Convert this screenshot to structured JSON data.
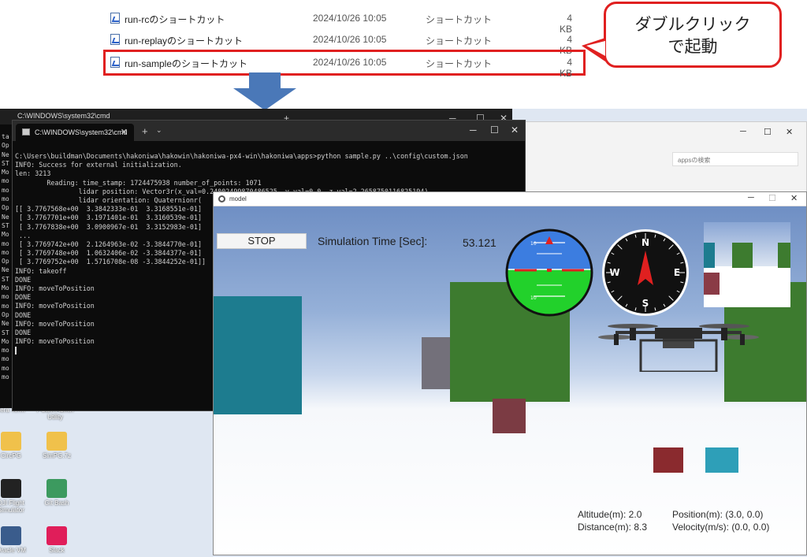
{
  "files": [
    {
      "name": "run-rcのショートカット",
      "date": "2024/10/26 10:05",
      "type": "ショートカット",
      "size": "4 KB"
    },
    {
      "name": "run-replayのショートカット",
      "date": "2024/10/26 10:05",
      "type": "ショートカット",
      "size": "4 KB"
    },
    {
      "name": "run-sampleのショートカット",
      "date": "2024/10/26 10:05",
      "type": "ショートカット",
      "size": "4 KB"
    }
  ],
  "callout": {
    "line1": "ダブルクリック",
    "line2": "で起動"
  },
  "terminal": {
    "tab_title": "C:\\WINDOWS\\system32\\cmd",
    "back_tab_title": "C:\\WINDOWS\\system32\\cmd",
    "lines": [
      "C:\\Users\\buildman\\Documents\\hakoniwa\\hakowin\\hakoniwa-px4-win\\hakoniwa\\apps>python sample.py ..\\config\\custom.json",
      "INFO: Success for external initialization.",
      "len: 3213",
      "        Reading: time_stamp: 1724475938 number_of_points: 1071",
      "                lidar position: Vector3r(x_val=0.24002499870486525, y_val=0.0, z_val=2.2658750116825194)",
      "                lidar orientation: Quaternionr(",
      "[[ 3.7767568e+00  3.3842333e-01  3.3168551e-01]",
      " [ 3.7767701e+00  3.1971401e-01  3.3160539e-01]",
      " [ 3.7767838e+00  3.0900967e-01  3.3152983e-01]",
      " ...",
      " [ 3.7769742e+00  2.1264963e-02 -3.3844770e-01]",
      " [ 3.7769748e+00  1.0632406e-02 -3.3844377e-01]",
      " [ 3.7769752e+00  1.5716708e-08 -3.3844252e-01]]",
      "INFO: takeoff",
      "DONE",
      "INFO: moveToPosition",
      "DONE",
      "INFO: moveToPosition",
      "DONE",
      "INFO: moveToPosition",
      "DONE",
      "INFO: moveToPosition"
    ],
    "back_lines": [
      "ta",
      "Op",
      "Ne",
      "ST",
      "Mo",
      "mo",
      "mo",
      "mo",
      "Op",
      "Ne",
      "ST",
      "Mo",
      "mo",
      "mo",
      "Op",
      "Ne",
      "ST",
      "Mo",
      "mo",
      "mo",
      "Op",
      "Ne",
      "ST",
      "Mo",
      "mo",
      "mo",
      "mo",
      "mo"
    ]
  },
  "explorer": {
    "search_placeholder": "appsの検索"
  },
  "sim": {
    "window_title": "model",
    "stop_label": "STOP",
    "sim_time_label": "Simulation Time [Sec]:",
    "sim_time_value": "53.121",
    "readouts": {
      "altitude": "Altitude(m): 2.0",
      "position": "Position(m): (3.0, 0.0)",
      "distance": "Distance(m): 8.3",
      "velocity": "Velocity(m/s): (0.0, 0.0)"
    },
    "attitude_ticks": [
      "10",
      "10"
    ],
    "compass": {
      "n": "N",
      "s": "S",
      "e": "E",
      "w": "W"
    }
  },
  "desktop_icons": [
    {
      "label": "Tera Term",
      "color": "#6a6a6a"
    },
    {
      "label": "PCam Admin Utility",
      "color": "#2f6fc1"
    },
    {
      "label": "CircPG",
      "color": "#f0c14b"
    },
    {
      "label": "SimPG.7z",
      "color": "#f0c14b"
    },
    {
      "label": "DJI Flight Simulator",
      "color": "#222222"
    },
    {
      "label": "Git Bash",
      "color": "#3c9a5f"
    },
    {
      "label": "Oracle VM",
      "color": "#3a5c8c"
    },
    {
      "label": "Slack",
      "color": "#e01e5a"
    }
  ],
  "colors": {
    "highlight_red": "#e02020",
    "arrow_blue": "#4a78b8",
    "cube_teal": "#1d7c8f",
    "cube_green": "#3d7b2f",
    "cube_maroon": "#7b3b43"
  }
}
